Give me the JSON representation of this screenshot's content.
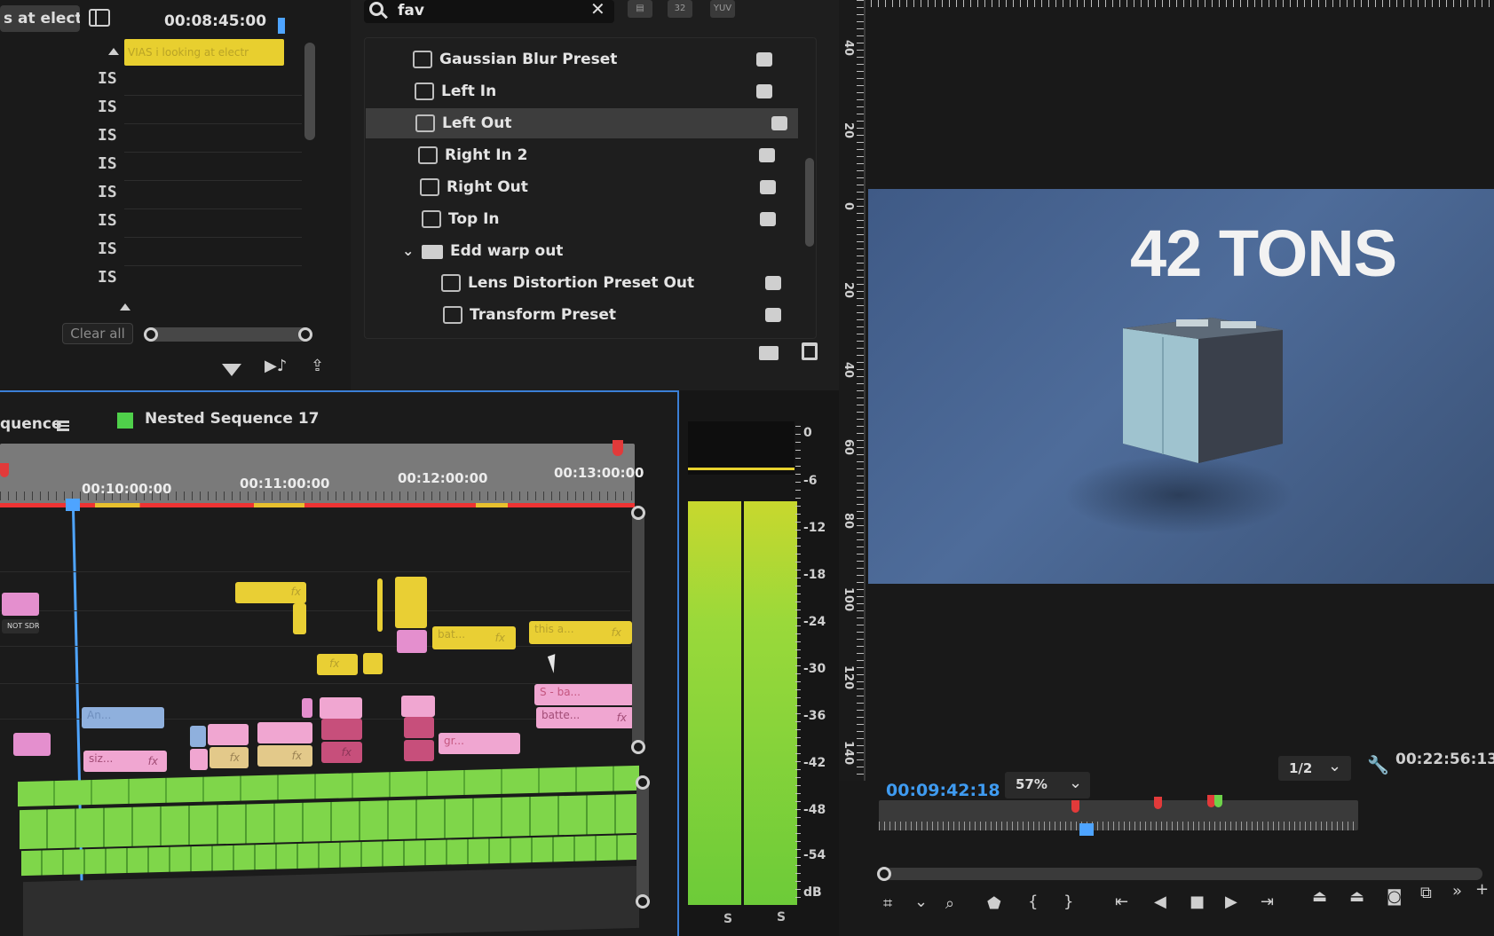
{
  "markers_panel": {
    "tab_label": "s at elect...",
    "timecode": "00:08:45:00",
    "marker_clip_label": "VIAS i looking at electr",
    "clear_all_label": "Clear all"
  },
  "effects_panel": {
    "search_value": "fav",
    "badge_32": "32",
    "badge_yuv": "YUV",
    "items": [
      {
        "label": "Gaussian Blur Preset",
        "type": "preset",
        "indent": 0,
        "selected": false
      },
      {
        "label": "Left In",
        "type": "preset",
        "indent": 0,
        "selected": false
      },
      {
        "label": "Left Out",
        "type": "preset",
        "indent": 0,
        "selected": true
      },
      {
        "label": "Right In 2",
        "type": "preset",
        "indent": 0,
        "selected": false
      },
      {
        "label": "Right Out",
        "type": "preset",
        "indent": 0,
        "selected": false
      },
      {
        "label": "Top In",
        "type": "preset",
        "indent": 0,
        "selected": false
      },
      {
        "label": "Edd warp out",
        "type": "folder",
        "indent": 0,
        "selected": false
      },
      {
        "label": "Lens Distortion Preset Out",
        "type": "preset",
        "indent": 1,
        "selected": false
      },
      {
        "label": "Transform Preset",
        "type": "preset",
        "indent": 1,
        "selected": false
      }
    ]
  },
  "timeline": {
    "tab_label": "quence",
    "nested_sequence_label": "Nested Sequence 17",
    "nested_color": "#4fd04a",
    "ruler_times": [
      "00:10:00:00",
      "00:11:00:00",
      "00:12:00:00",
      "00:13:00:00"
    ],
    "clips": {
      "bat": "bat...",
      "this": "this a...",
      "an": "An...",
      "sba": "S - ba...",
      "batte": "batte...",
      "siz": "siz...",
      "gr": "gr...",
      "fx": "fx",
      "notsdr": "NOT SDR"
    }
  },
  "meters": {
    "scale": [
      "0",
      "-6",
      "-12",
      "-18",
      "-24",
      "-30",
      "-36",
      "-42",
      "-48",
      "-54",
      "dB"
    ],
    "channel_labels": [
      "S",
      "S"
    ]
  },
  "program_monitor": {
    "ruler_marks": [
      "40",
      "20",
      "0",
      "20",
      "40",
      "60",
      "80",
      "100",
      "120",
      "140"
    ],
    "overlay_text": "42 TONS",
    "current_timecode": "00:09:42:18",
    "zoom": "57%",
    "resolution": "1/2",
    "duration_timecode": "00:22:56:13",
    "timecode_color": "#3f9bf0"
  }
}
